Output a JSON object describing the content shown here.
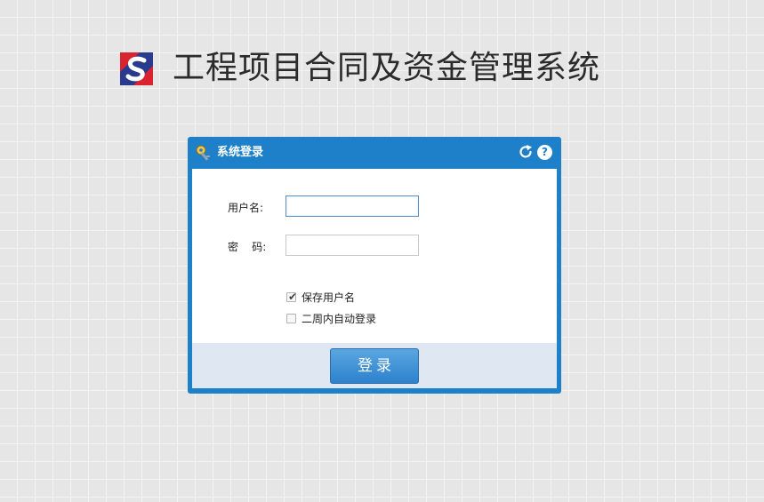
{
  "app": {
    "title": "工程项目合同及资金管理系统",
    "logo_icon": "company-logo-s"
  },
  "login_panel": {
    "title": "系统登录",
    "header_icons": [
      "key-icon",
      "refresh-icon",
      "help-icon"
    ],
    "help_glyph": "?",
    "username": {
      "label": "用户名:",
      "value": "",
      "placeholder": ""
    },
    "password": {
      "label": "密    码:",
      "value": "",
      "placeholder": ""
    },
    "remember_username": {
      "label": "保存用户名",
      "checked": true
    },
    "auto_login": {
      "label": "二周内自动登录",
      "checked": false
    },
    "submit_label": "登录"
  },
  "colors": {
    "accent": "#1d80c9",
    "footer_bg": "#dfe8f2",
    "page_bg": "#e6e6e6"
  }
}
